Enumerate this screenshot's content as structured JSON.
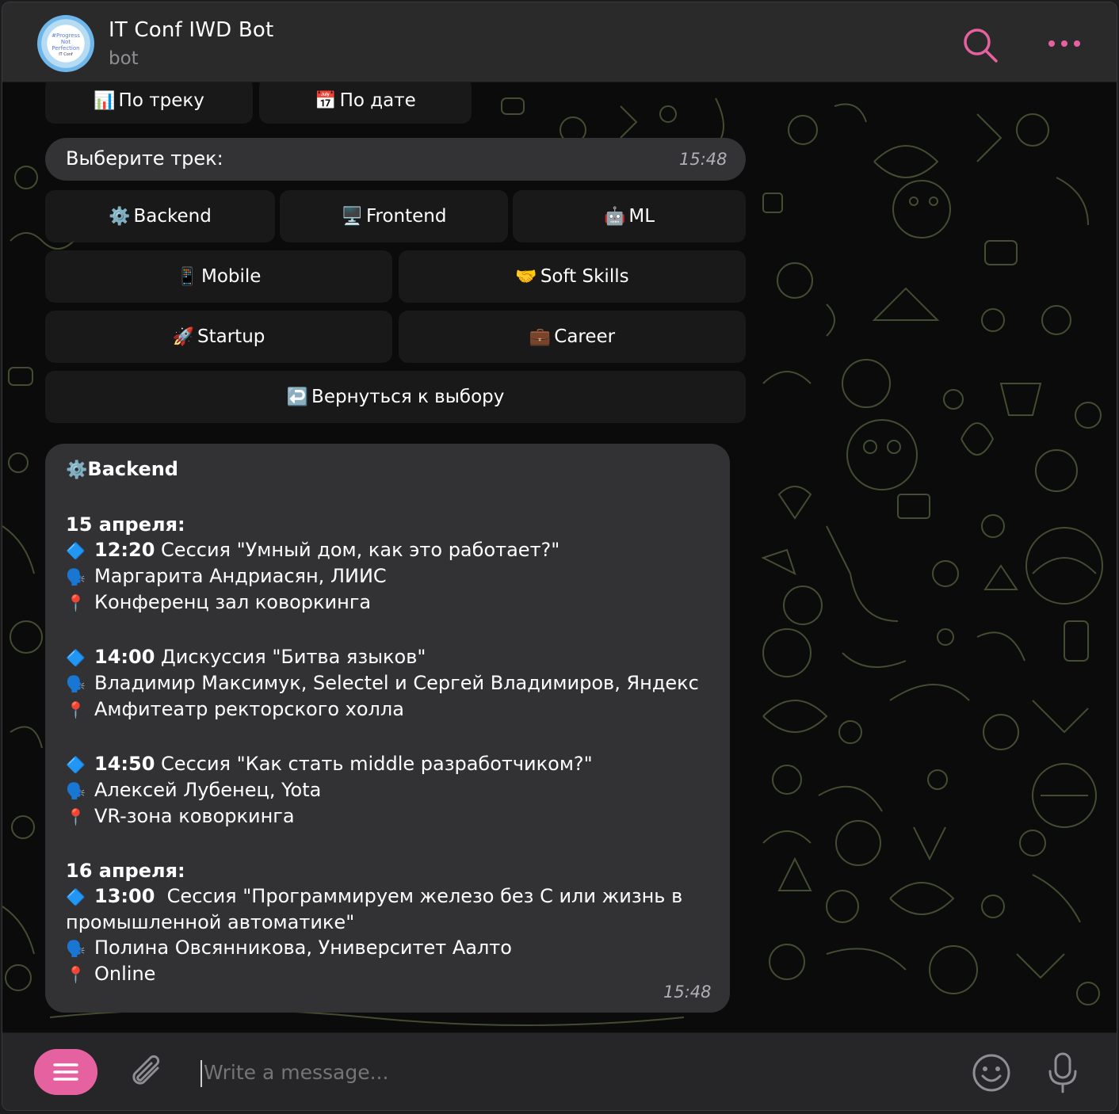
{
  "header": {
    "title": "IT Conf IWD Bot",
    "subtitle": "bot",
    "avatar_text": [
      "#Progress",
      "Not",
      "Perfection",
      "IT Conf"
    ]
  },
  "top_buttons": [
    {
      "emoji": "📊",
      "label": "По треку"
    },
    {
      "emoji": "📅",
      "label": "По дате"
    }
  ],
  "prompt_message": {
    "text": "Выберите трек:",
    "time": "15:48"
  },
  "track_buttons": [
    {
      "emoji": "⚙️",
      "label": "Backend"
    },
    {
      "emoji": "🖥️",
      "label": "Frontend"
    },
    {
      "emoji": "🤖",
      "label": "ML"
    },
    {
      "emoji": "📱",
      "label": "Mobile"
    },
    {
      "emoji": "🤝",
      "label": "Soft Skills"
    },
    {
      "emoji": "🚀",
      "label": "Startup"
    },
    {
      "emoji": "💼",
      "label": "Career"
    },
    {
      "emoji": "↩️",
      "label": "Вернуться к выбору"
    }
  ],
  "schedule_message": {
    "heading_emoji": "⚙️",
    "heading": "Backend",
    "day1": "15 апреля:",
    "s1_time": "12:20",
    "s1_title": "Сессия \"Умный дом, как это работает?\"",
    "s1_speaker": "Маргарита Андриасян, ЛИИС",
    "s1_place": "Конференц зал коворкинга",
    "s2_time": "14:00",
    "s2_title": "Дискуссия \"Битва языков\"",
    "s2_speaker": "Владимир Максимук, Selectel и Сергей Владимиров, Яндекс",
    "s2_place": "Амфитеатр ректорского холла",
    "s3_time": "14:50",
    "s3_title": "Сессия \"Как стать middle разработчиком?\"",
    "s3_speaker": "Алексей Лубенец, Yota",
    "s3_place": "VR-зона коворкинга",
    "day2": "16 апреля:",
    "s4_time": "13:00",
    "s4_title": "Сессия \"Программируем железо без С или жизнь в промышленной автоматике\"",
    "s4_speaker": "Полина Овсянникова, Университет Аалто",
    "s4_place": "Online",
    "time": "15:48",
    "icons": {
      "session": "🔷",
      "speaker": "🗣️",
      "place": "📍"
    }
  },
  "input": {
    "placeholder": "Write a message..."
  },
  "colors": {
    "accent": "#e6619f",
    "bubble": "#323234",
    "header": "#2a2a2b",
    "doodle": "#5a6b4a"
  },
  "icons": [
    "search-icon",
    "more-icon",
    "menu-icon",
    "attach-icon",
    "emoji-icon",
    "mic-icon"
  ]
}
